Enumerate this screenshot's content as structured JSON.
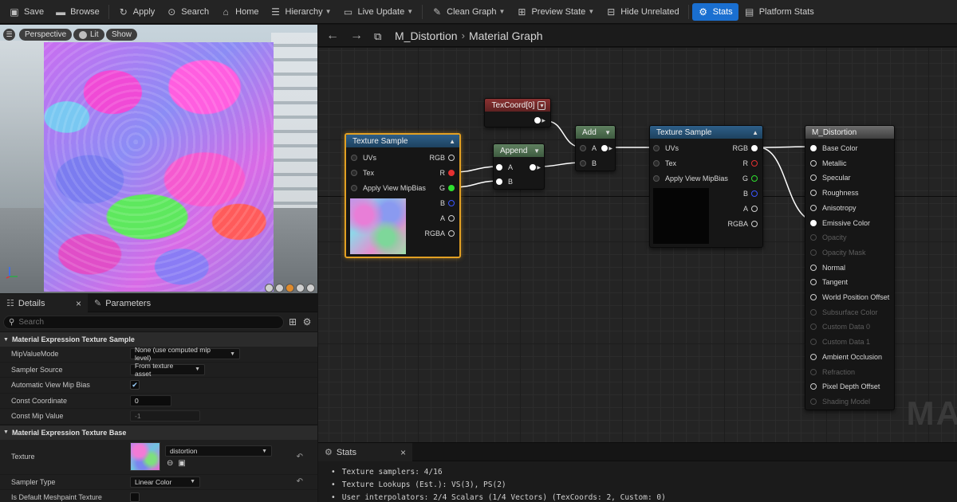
{
  "toolbar": {
    "save": "Save",
    "browse": "Browse",
    "apply": "Apply",
    "search": "Search",
    "home": "Home",
    "hierarchy": "Hierarchy",
    "live_update": "Live Update",
    "clean_graph": "Clean Graph",
    "preview_state": "Preview State",
    "hide_unrelated": "Hide Unrelated",
    "stats": "Stats",
    "platform_stats": "Platform Stats"
  },
  "viewport": {
    "perspective": "Perspective",
    "lit": "Lit",
    "show": "Show"
  },
  "details": {
    "tab_details": "Details",
    "tab_parameters": "Parameters",
    "search_placeholder": "Search",
    "section1": "Material Expression Texture Sample",
    "mip_value_mode_label": "MipValueMode",
    "mip_value_mode_value": "None (use computed mip level)",
    "sampler_source_label": "Sampler Source",
    "sampler_source_value": "From texture asset",
    "auto_mip_bias_label": "Automatic View Mip Bias",
    "const_coord_label": "Const Coordinate",
    "const_coord_value": "0",
    "const_mip_label": "Const Mip Value",
    "const_mip_value": "-1",
    "section2": "Material Expression Texture Base",
    "texture_label": "Texture",
    "texture_value": "distortion",
    "sampler_type_label": "Sampler Type",
    "sampler_type_value": "Linear Color",
    "default_meshpaint_label": "Is Default Meshpaint Texture"
  },
  "graph": {
    "material_name": "M_Distortion",
    "title": "Material Graph",
    "watermark": "MA",
    "tex_sample_1": {
      "title": "Texture Sample",
      "uvs": "UVs",
      "tex": "Tex",
      "mipbias": "Apply View MipBias",
      "rgb": "RGB",
      "r": "R",
      "g": "G",
      "b": "B",
      "a": "A",
      "rgba": "RGBA"
    },
    "texcoord": {
      "title": "TexCoord[0]"
    },
    "append": {
      "title": "Append",
      "a": "A",
      "b": "B"
    },
    "add": {
      "title": "Add",
      "a": "A",
      "b": "B"
    },
    "tex_sample_2": {
      "title": "Texture Sample",
      "uvs": "UVs",
      "tex": "Tex",
      "mipbias": "Apply View MipBias",
      "rgb": "RGB",
      "r": "R",
      "g": "G",
      "b": "B",
      "a": "A",
      "rgba": "RGBA"
    },
    "result": {
      "title": "M_Distortion",
      "pins": [
        "Base Color",
        "Metallic",
        "Specular",
        "Roughness",
        "Anisotropy",
        "Emissive Color",
        "Opacity",
        "Opacity Mask",
        "Normal",
        "Tangent",
        "World Position Offset",
        "Subsurface Color",
        "Custom Data 0",
        "Custom Data 1",
        "Ambient Occlusion",
        "Refraction",
        "Pixel Depth Offset",
        "Shading Model"
      ]
    }
  },
  "stats": {
    "tab": "Stats",
    "lines": [
      "Texture samplers: 4/16",
      "Texture Lookups (Est.): VS(3), PS(2)",
      "User interpolators: 2/4 Scalars (1/4 Vectors) (TexCoords: 2, Custom: 0)"
    ]
  }
}
